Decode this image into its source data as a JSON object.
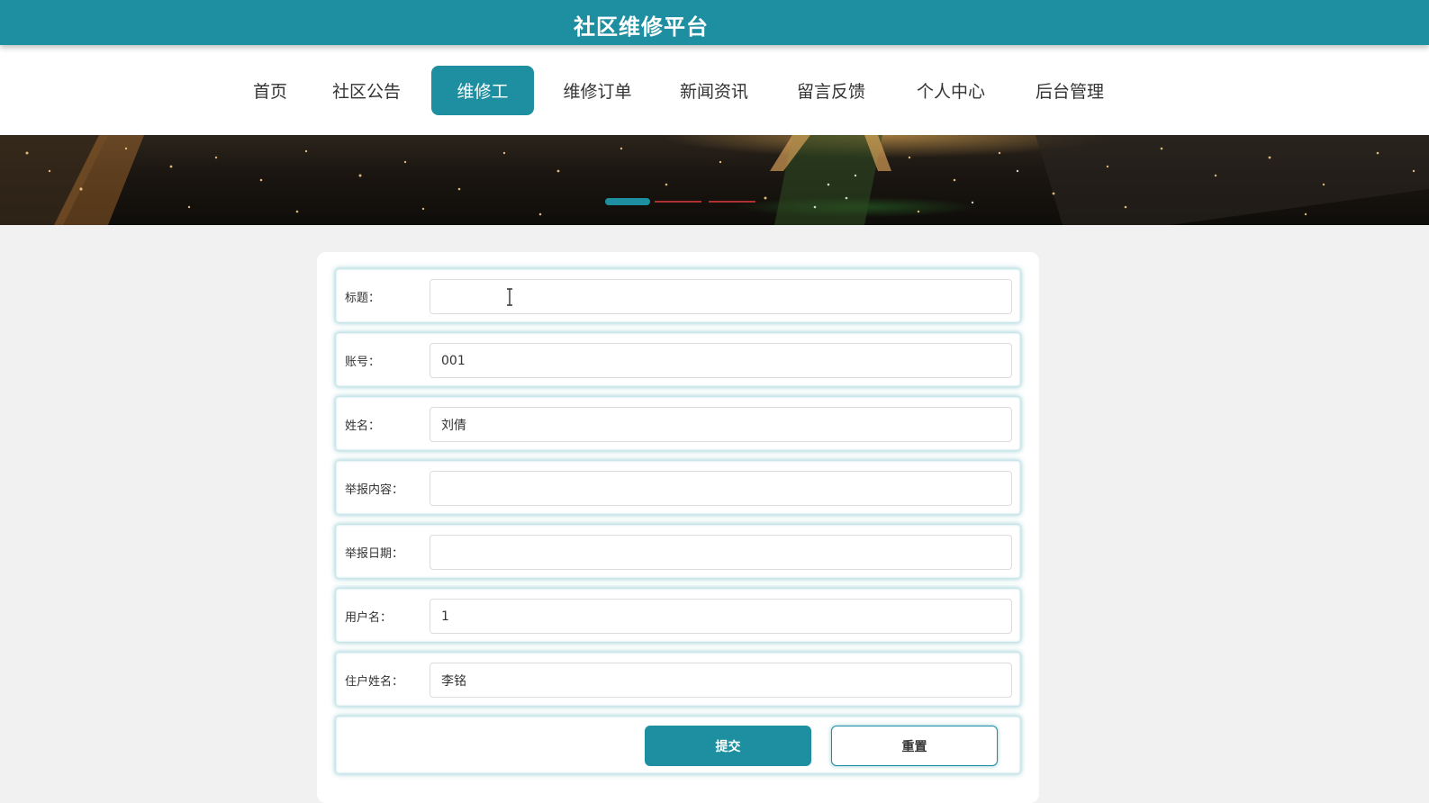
{
  "header": {
    "site_title": "社区维修平台",
    "accent_color": "#1e8fa0"
  },
  "nav": {
    "items": [
      {
        "label": "首页",
        "active": false
      },
      {
        "label": "社区公告",
        "active": false
      },
      {
        "label": "维修工",
        "active": true
      },
      {
        "label": "维修订单",
        "active": false
      },
      {
        "label": "新闻资讯",
        "active": false
      },
      {
        "label": "留言反馈",
        "active": false
      },
      {
        "label": "个人中心",
        "active": false
      },
      {
        "label": "后台管理",
        "active": false
      }
    ]
  },
  "banner": {
    "image": "city-night-aerial",
    "carousel_active_index": 0,
    "carousel_count": 3
  },
  "form": {
    "fields": [
      {
        "label": "标题：",
        "value": "",
        "focused": true
      },
      {
        "label": "账号：",
        "value": "001"
      },
      {
        "label": "姓名：",
        "value": "刘倩"
      },
      {
        "label": "举报内容：",
        "value": ""
      },
      {
        "label": "举报日期：",
        "value": ""
      },
      {
        "label": "用户名：",
        "value": "1"
      },
      {
        "label": "住户姓名：",
        "value": "李铭"
      }
    ],
    "submit_label": "提交",
    "reset_label": "重置"
  }
}
